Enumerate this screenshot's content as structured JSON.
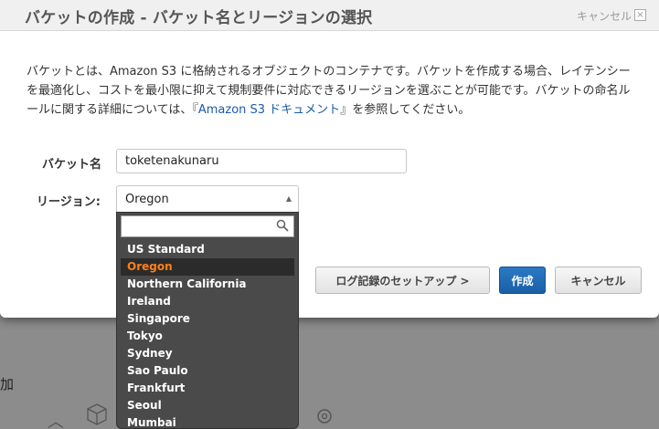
{
  "modal": {
    "title": "バケットの作成 - バケット名とリージョンの選択",
    "header_cancel": "キャンセル",
    "close_glyph": "×"
  },
  "description": {
    "text_before_link": "バケットとは、Amazon S3 に格納されるオブジェクトのコンテナです。バケットを作成する場合、レイテンシーを最適化し、コストを最小限に抑えて規制要件に対応できるリージョンを選ぶことが可能です。バケットの命名ルールに関する詳細については、『",
    "link_text": "Amazon S3 ドキュメント",
    "text_after_link": "』を参照してください。"
  },
  "form": {
    "bucket_label": "バケット名",
    "bucket_value": "toketenakunaru",
    "region_label": "リージョン:",
    "region_value": "Oregon"
  },
  "dropdown": {
    "search_value": "",
    "selected_index": 1,
    "options": [
      "US Standard",
      "Oregon",
      "Northern California",
      "Ireland",
      "Singapore",
      "Tokyo",
      "Sydney",
      "Sao Paulo",
      "Frankfurt",
      "Seoul",
      "Mumbai"
    ]
  },
  "buttons": {
    "logging": "ログ記録のセットアップ >",
    "create": "作成",
    "cancel": "キャンセル"
  },
  "background": {
    "partial_text": "加"
  },
  "colors": {
    "accent_blue": "#1a5fa8",
    "selected_orange": "#ff7f1a"
  },
  "icons": {
    "search": "search-icon",
    "close": "close-icon",
    "dropdown_arrow": "triangle-up-icon"
  }
}
